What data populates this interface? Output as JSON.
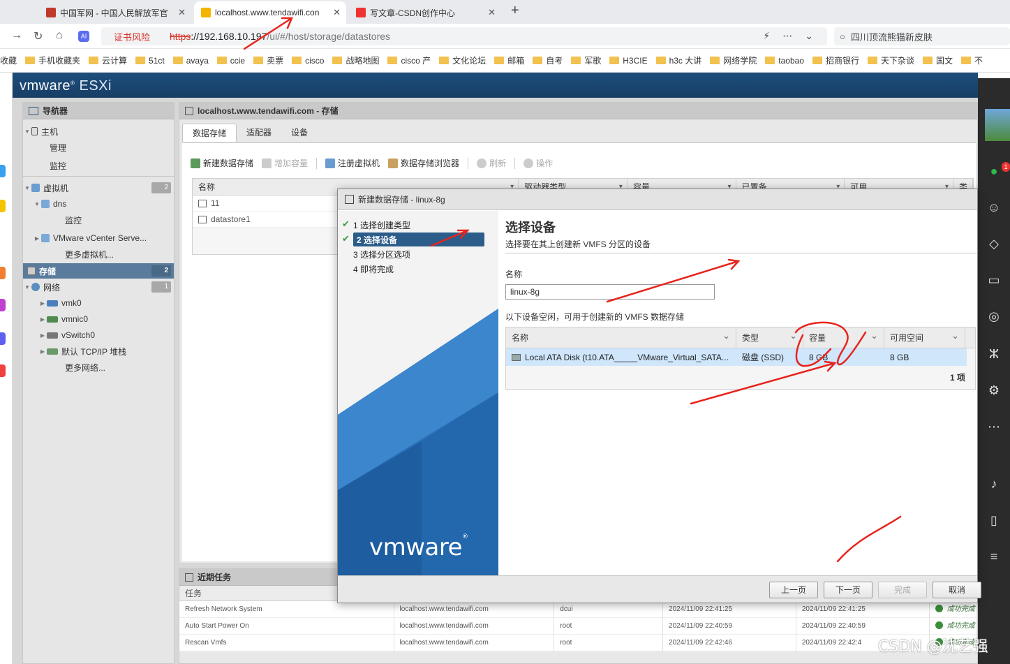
{
  "browser": {
    "tabs": [
      {
        "title": "中国军网 - 中国人民解放军官"
      },
      {
        "title": "localhost.www.tendawifi.con"
      },
      {
        "title": "写文章-CSDN创作中心"
      }
    ],
    "cert_warning": "证书风险",
    "url_scheme": "https",
    "url_host": "://192.168.10.197",
    "url_path": "/ui/#/host/storage/datastores",
    "search_text": "四川顶流熊猫新皮肤"
  },
  "bookmarks": [
    "收藏",
    "手机收藏夹",
    "云计算",
    "51ct",
    "avaya",
    "ccie",
    "卖票",
    "cisco",
    "战略地图",
    "cisco 产",
    "文化论坛",
    "邮箱",
    "自考",
    "军歌",
    "H3CIE",
    "h3c 大讲",
    "网络学院",
    "taobao",
    "招商银行",
    "天下杂谈",
    "国文",
    "不"
  ],
  "esxi": {
    "logo_main": "vmware",
    "logo_product": "ESXi",
    "navigator": {
      "title": "导航器",
      "host": "主机",
      "manage": "管理",
      "monitor": "监控",
      "vms": "虚拟机",
      "vms_count": "2",
      "dns": "dns",
      "dns_monitor": "监控",
      "vcenter": "VMware vCenter Serve...",
      "more_vms": "更多虚拟机...",
      "storage": "存储",
      "storage_count": "2",
      "network": "网络",
      "network_count": "1",
      "vmk0": "vmk0",
      "vmnic0": "vmnic0",
      "vswitch0": "vSwitch0",
      "tcpip": "默认 TCP/IP 堆栈",
      "more_networks": "更多网络..."
    },
    "main": {
      "title": "localhost.www.tendawifi.com - 存储",
      "tabs": [
        "数据存储",
        "适配器",
        "设备"
      ],
      "toolbar": {
        "new_datastore": "新建数据存储",
        "increase": "增加容量",
        "register_vm": "注册虚拟机",
        "browser": "数据存储浏览器",
        "refresh": "刷新",
        "actions": "操作"
      },
      "columns": [
        "名称",
        "驱动器类型",
        "容量",
        "已置备",
        "可用",
        "类型"
      ],
      "rows": [
        "11",
        "datastore1"
      ]
    },
    "recent": {
      "title": "近期任务",
      "task_header": "任务",
      "rows": [
        {
          "task": "Refresh Network System",
          "target": "localhost.www.tendawifi.com",
          "user": "dcui",
          "queued": "2024/11/09 22:41:25",
          "started": "2024/11/09 22:41:25",
          "result": "成功完成"
        },
        {
          "task": "Auto Start Power On",
          "target": "localhost.www.tendawifi.com",
          "user": "root",
          "queued": "2024/11/09 22:40:59",
          "started": "2024/11/09 22:40:59",
          "result": "成功完成"
        },
        {
          "task": "Rescan Vmfs",
          "target": "localhost.www.tendawifi.com",
          "user": "root",
          "queued": "2024/11/09 22:42:46",
          "started": "2024/11/09 22:42:4",
          "result": "成功完成"
        }
      ]
    }
  },
  "wizard": {
    "title": "新建数据存储 - linux-8g",
    "steps": [
      "1 选择创建类型",
      "2 选择设备",
      "3 选择分区选项",
      "4 即将完成"
    ],
    "heading": "选择设备",
    "subheading": "选择要在其上创建新 VMFS 分区的设备",
    "name_label": "名称",
    "name_value": "linux-8g",
    "device_desc": "以下设备空闲，可用于创建新的 VMFS 数据存储",
    "columns": [
      "名称",
      "类型",
      "容量",
      "可用空间"
    ],
    "device": {
      "name": "Local ATA Disk (t10.ATA_____VMware_Virtual_SATA...",
      "type": "磁盘 (SSD)",
      "capacity": "8 GB",
      "free": "8 GB"
    },
    "count": "1 项",
    "logo": "vmware",
    "buttons": {
      "prev": "上一页",
      "next": "下一页",
      "finish": "完成",
      "cancel": "取消"
    }
  },
  "watermark": "CSDN @沈艺强"
}
